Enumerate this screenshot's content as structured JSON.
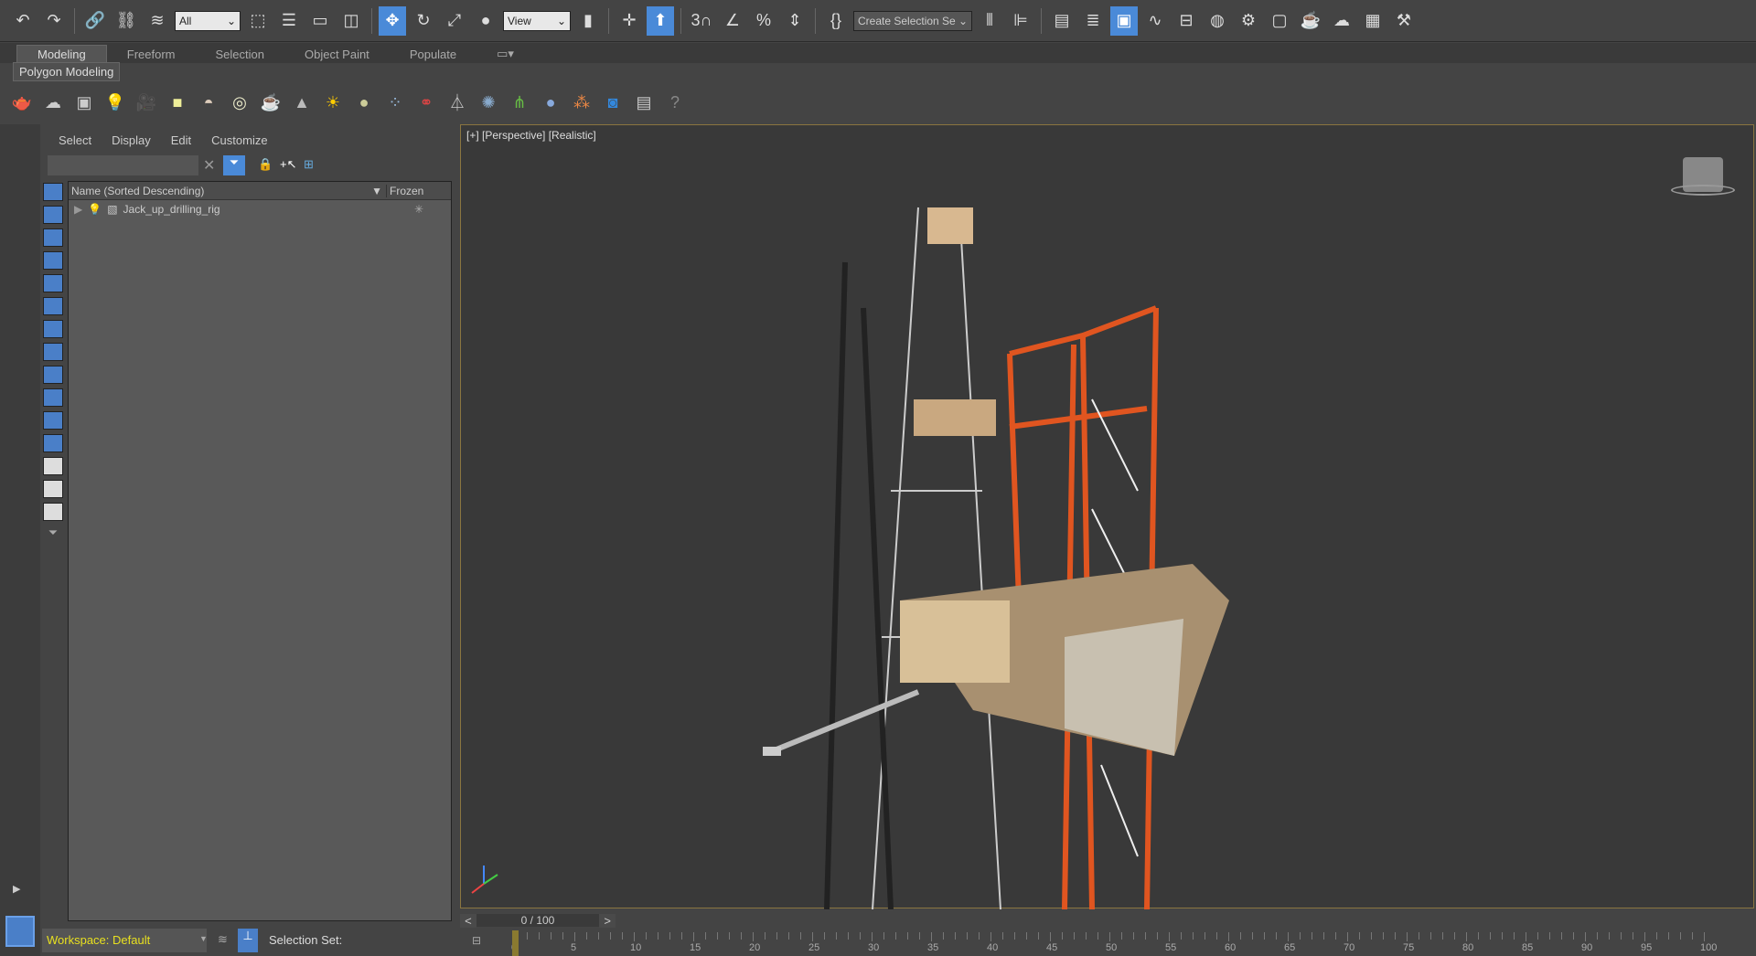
{
  "toolbar": {
    "selection_filter": "All",
    "reference_coord": "View",
    "named_selection": "Create Selection Se"
  },
  "ribbon": {
    "tabs": [
      "Modeling",
      "Freeform",
      "Selection",
      "Object Paint",
      "Populate"
    ],
    "active": "Modeling",
    "panel": "Polygon Modeling"
  },
  "explorer": {
    "menu": [
      "Select",
      "Display",
      "Edit",
      "Customize"
    ],
    "search_placeholder": "",
    "columns": [
      "Name (Sorted Descending)",
      "Frozen"
    ],
    "rows": [
      {
        "name": "Jack_up_drilling_rig",
        "frozen": "✳"
      }
    ]
  },
  "viewport": {
    "label": "[+] [Perspective] [Realistic]"
  },
  "timeline": {
    "position": "0 / 100",
    "prev": "<",
    "next": ">",
    "ticks": [
      0,
      5,
      10,
      15,
      20,
      25,
      30,
      35,
      40,
      45,
      50,
      55,
      60,
      65,
      70,
      75,
      80,
      85,
      90,
      95,
      100
    ]
  },
  "statusbar": {
    "workspace": "Workspace: Default",
    "selection_set": "Selection Set:"
  }
}
